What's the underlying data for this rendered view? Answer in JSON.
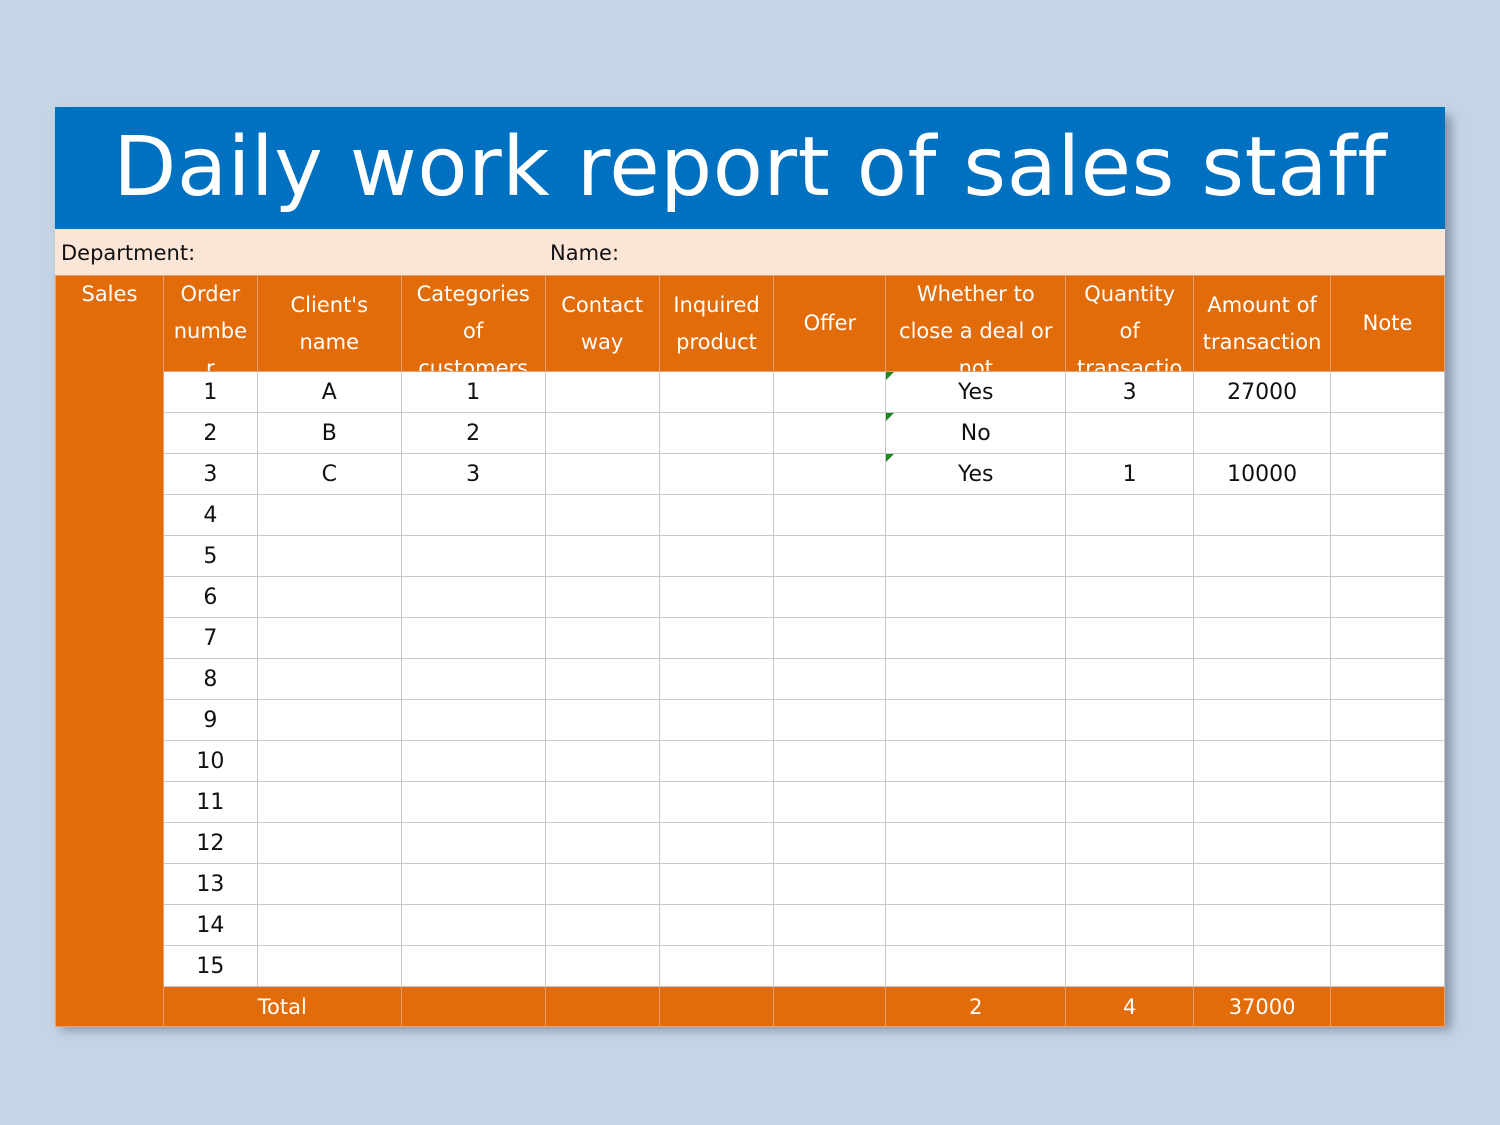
{
  "title": "Daily work report of sales staff",
  "info": {
    "department_label": "Department:",
    "name_label": "Name:"
  },
  "side_label": "Sales",
  "headers": [
    [
      "Order",
      "numbe",
      "r"
    ],
    [
      "Client's",
      "name"
    ],
    [
      "Categories",
      "of",
      "customers"
    ],
    [
      "Contact",
      "way"
    ],
    [
      "Inquired",
      "product"
    ],
    [
      "Offer"
    ],
    [
      "Whether to",
      "close a deal or",
      "not"
    ],
    [
      "Quantity",
      "of",
      "transactio"
    ],
    [
      "Amount of",
      "transaction"
    ],
    [
      "Note"
    ]
  ],
  "rows": [
    {
      "order": "1",
      "client": "A",
      "category": "1",
      "deal": "Yes",
      "quantity": "3",
      "amount": "27000"
    },
    {
      "order": "2",
      "client": "B",
      "category": "2",
      "deal": "No",
      "quantity": "",
      "amount": ""
    },
    {
      "order": "3",
      "client": "C",
      "category": "3",
      "deal": "Yes",
      "quantity": "1",
      "amount": "10000"
    },
    {
      "order": "4"
    },
    {
      "order": "5"
    },
    {
      "order": "6"
    },
    {
      "order": "7"
    },
    {
      "order": "8"
    },
    {
      "order": "9"
    },
    {
      "order": "10"
    },
    {
      "order": "11"
    },
    {
      "order": "12"
    },
    {
      "order": "13"
    },
    {
      "order": "14"
    },
    {
      "order": "15"
    }
  ],
  "total": {
    "label": "Total",
    "deal": "2",
    "quantity": "4",
    "amount": "37000"
  },
  "colors": {
    "title_bg": "#0070c0",
    "header_bg": "#e36c0a",
    "info_bg": "#fbe5d6",
    "page_bg": "#c5d5e5"
  }
}
